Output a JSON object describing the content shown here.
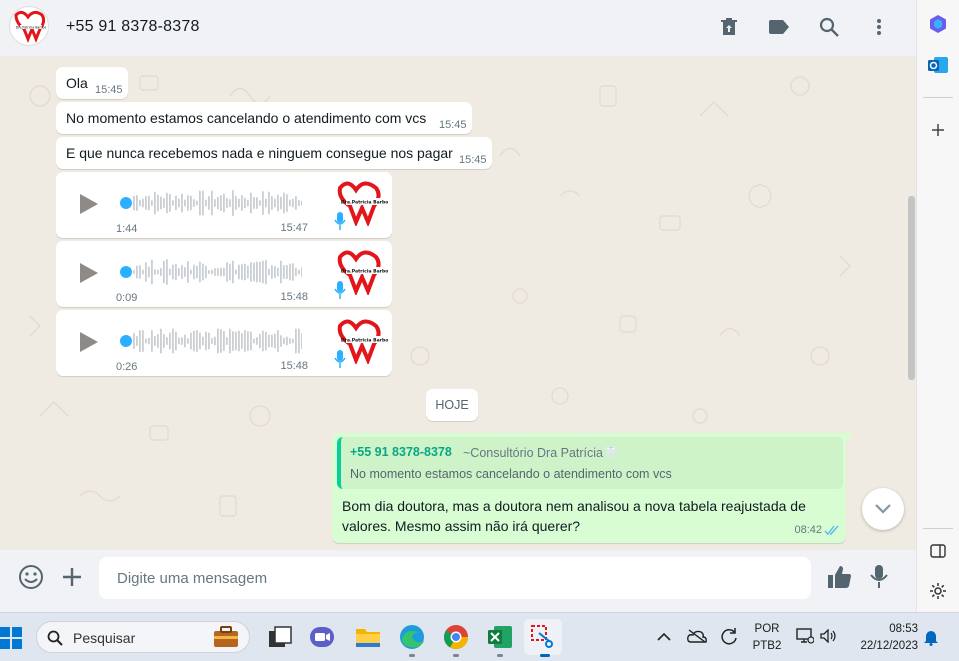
{
  "header": {
    "contact": "+55 91 8378-8378",
    "icons": [
      "delete-icon",
      "label-icon",
      "search-icon",
      "menu-icon"
    ]
  },
  "messages": [
    {
      "text": "Ola",
      "time": "15:45"
    },
    {
      "text": "No momento estamos cancelando o atendimento com vcs",
      "time": "15:45"
    },
    {
      "text": "E que nunca recebemos nada e ninguem consegue nos pagar",
      "time": "15:45"
    }
  ],
  "audios": [
    {
      "duration": "1:44",
      "time": "15:47"
    },
    {
      "duration": "0:09",
      "time": "15:48"
    },
    {
      "duration": "0:26",
      "time": "15:48"
    }
  ],
  "avatar_logo_text": "Dra.Patricia Barbos",
  "date_chip": "HOJE",
  "outgoing": {
    "quote_author": "+55 91 8378-8378",
    "quote_subtitle": "~Consultório Dra Patrícia🦷",
    "quote_text": "No momento estamos cancelando o atendimento com vcs",
    "text": "Bom dia doutora, mas a doutora nem analisou a nova tabela reajustada de valores. Mesmo assim não irá querer?",
    "time": "08:42"
  },
  "composer": {
    "placeholder": "Digite uma mensagem"
  },
  "taskbar": {
    "search_label": "Pesquisar",
    "lang_top": "POR",
    "lang_bottom": "PTB2",
    "clock_time": "08:53",
    "clock_date": "22/12/2023"
  },
  "colors": {
    "accent_green": "#06cf9c",
    "outgoing_bg": "#d9fdd3",
    "audio_dot": "#2bb0ff",
    "logo_red": "#e3151a"
  }
}
